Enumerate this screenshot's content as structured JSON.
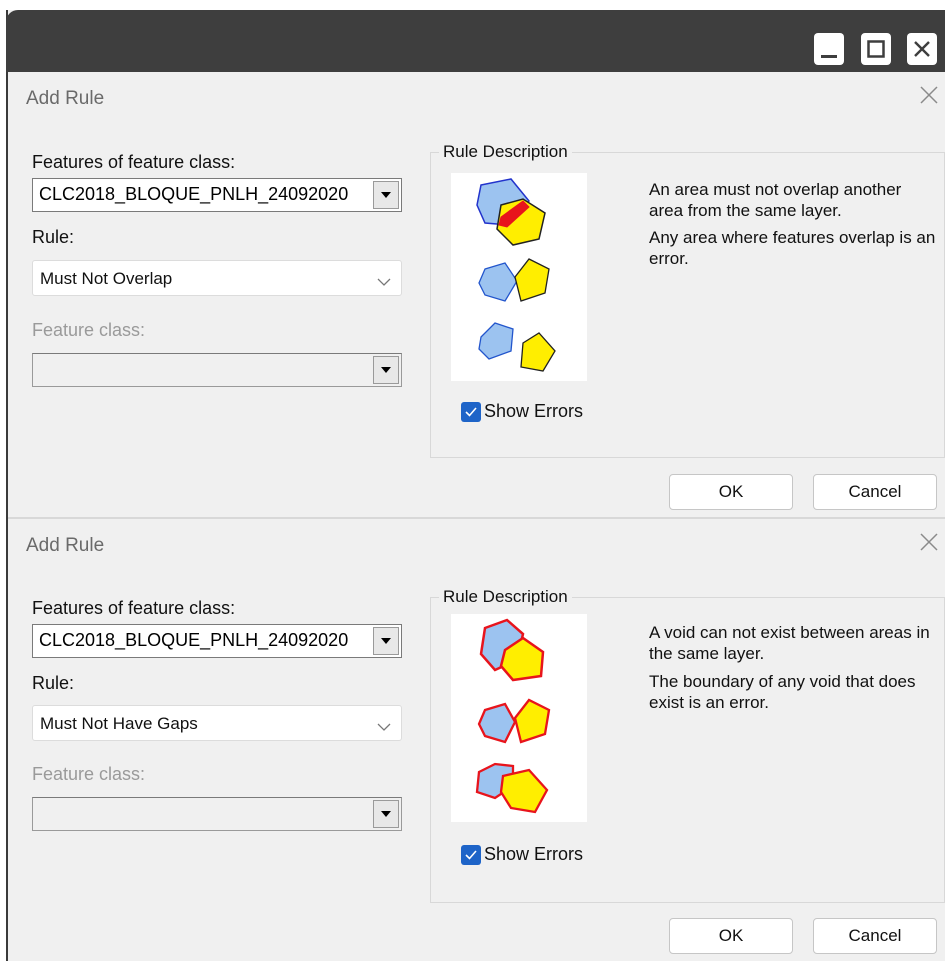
{
  "window": {
    "minimize_icon": "minimize-icon",
    "maximize_icon": "maximize-icon",
    "close_icon": "close-icon"
  },
  "dialogs": [
    {
      "title": "Add Rule",
      "features_label": "Features of feature class:",
      "features_value": "CLC2018_BLOQUE_PNLH_24092020",
      "rule_label": "Rule:",
      "rule_value": "Must Not Overlap",
      "feature_class_label": "Feature class:",
      "feature_class_value": "",
      "rule_description_label": "Rule Description",
      "description_1": "An area must not overlap another area from the same layer.",
      "description_2": "Any area where features overlap is an error.",
      "show_errors_label": "Show Errors",
      "show_errors_checked": true,
      "ok_label": "OK",
      "cancel_label": "Cancel"
    },
    {
      "title": "Add Rule",
      "features_label": "Features of feature class:",
      "features_value": "CLC2018_BLOQUE_PNLH_24092020",
      "rule_label": "Rule:",
      "rule_value": "Must Not Have Gaps",
      "feature_class_label": "Feature class:",
      "feature_class_value": "",
      "rule_description_label": "Rule Description",
      "description_1": "A void can not exist between areas in the same layer.",
      "description_2": "The boundary of any void that does exist is an error.",
      "show_errors_label": "Show Errors",
      "show_errors_checked": true,
      "ok_label": "OK",
      "cancel_label": "Cancel"
    }
  ],
  "colors": {
    "titlebar": "#3e3e3e",
    "polygon_blue": "#9cc3f0",
    "polygon_yellow": "#ffee00",
    "error_red": "#e8141c",
    "checkbox": "#1e64c8"
  }
}
